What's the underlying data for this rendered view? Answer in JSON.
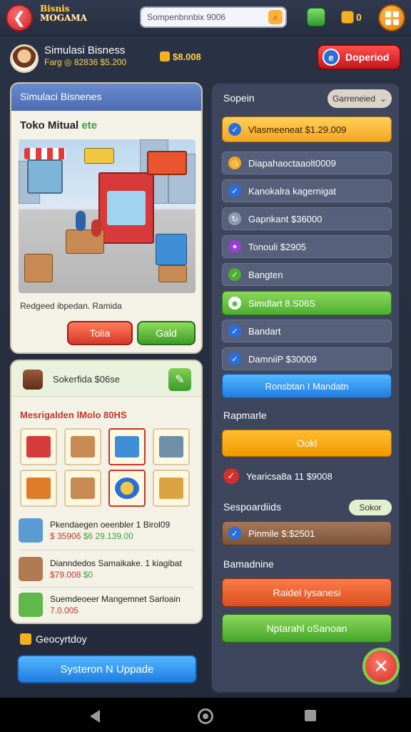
{
  "topbar": {
    "logo_line1": "Bisnis",
    "logo_line2": "MOGAMA",
    "search_placeholder": "Sompenbnnbix 9006",
    "coins_value": "0"
  },
  "profile": {
    "name": "Simulasi Bisness",
    "sub": "Farg ◎ 82836 $5.200",
    "money": "$8.008",
    "download_label": "Doperiod"
  },
  "store_card": {
    "header": "Simulaci Bisnenes",
    "title": "Toko Mitual",
    "title_accent": "ete",
    "caption": "Redgeed ibpedan. Ramida",
    "btn_red": "Tolia",
    "btn_green": "Gald"
  },
  "inventory_card": {
    "header": "Sokerfida $06se",
    "title": "Mesrigalden lMolo 80HS",
    "rows": [
      {
        "t1": "Pkendaegen oeenbler 1 Birol09",
        "t2a": "$ 35906",
        "t2b": "$6 29.139.00"
      },
      {
        "t1": "Dianndedos Samaikake. 1 kiagibat",
        "t2a": "$79.008",
        "t2b": "$0"
      },
      {
        "t1": "Suemdeoeer Mangemnet Sarloain",
        "t2a": "7.0.005",
        "t2b": ""
      }
    ]
  },
  "secured_label": "Geocyrtdoy",
  "system_button": "Systeron N Uppade",
  "right_panel": {
    "title": "Sopein",
    "dropdown": "Garreneied",
    "items": [
      {
        "label": "Vlasmeeneat $1.29.009",
        "style": "orange"
      },
      {
        "label": "Diapahaoctaaolt0009",
        "style": "dark"
      },
      {
        "label": "Kanokalra kagernigat",
        "style": "dark"
      },
      {
        "label": "Gapnkant $36000",
        "style": "dark"
      },
      {
        "label": "Tonouli $2905",
        "style": "dark"
      },
      {
        "label": "Bangten",
        "style": "dark"
      },
      {
        "label": "Simdlart 8.S06S",
        "style": "green"
      },
      {
        "label": "Bandart",
        "style": "dark"
      },
      {
        "label": "DamniiP $30009",
        "style": "dark"
      },
      {
        "label": "Ronsbtan I Mandatn",
        "style": "blue"
      }
    ],
    "section1": "Rapmarle",
    "ok_label": "Ookl",
    "check_label": "Yearicsa8a 11 $9008",
    "section2": "Sespoardiids",
    "sekor_label": "Sokor",
    "brown_label": "Pinmile $:$2501",
    "section3": "Bamadnine",
    "btn_orange": "Raidel Iysanesi",
    "btn_green": "Nptarahl oSanoan"
  },
  "colors": {
    "accent_red": "#d42a22",
    "accent_green": "#4caf30",
    "accent_orange": "#f5a623",
    "accent_blue": "#1f7de0"
  }
}
